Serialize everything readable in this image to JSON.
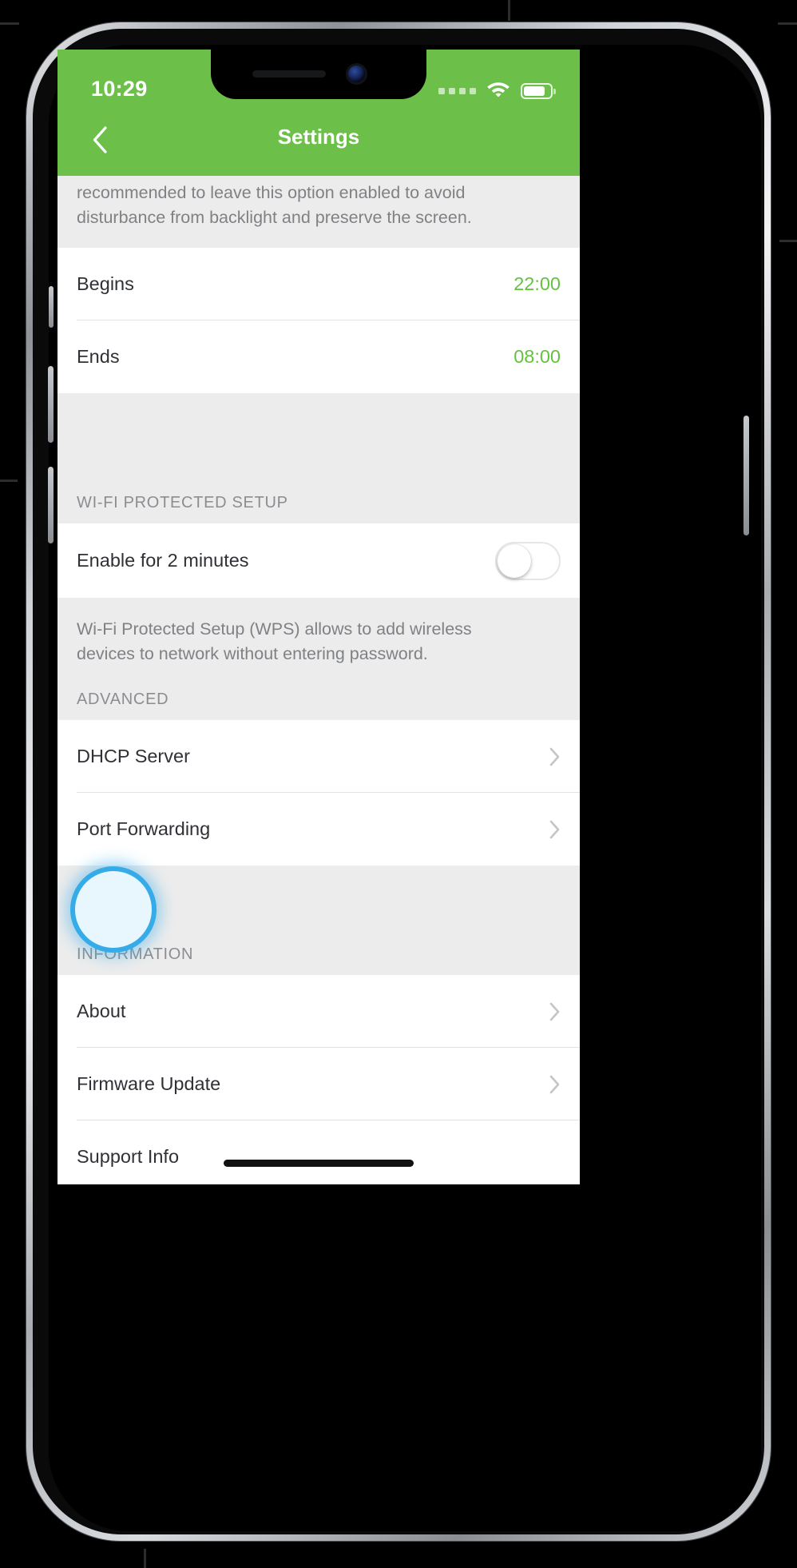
{
  "status_bar": {
    "time": "10:29",
    "signal_dots": 4,
    "wifi_icon": "wifi-icon",
    "battery_icon": "battery-icon",
    "battery_level_pct": 70
  },
  "nav": {
    "back_icon": "chevron-left-icon",
    "title": "Settings"
  },
  "colors": {
    "accent_green": "#6cc04a",
    "value_green": "#64c241",
    "group_bg": "#ececec",
    "row_bg": "#ffffff",
    "highlight_ring": "#35abe8",
    "highlight_fill": "#e8f6fd"
  },
  "night_mode_description": {
    "line1": "recommended to leave this option enabled to avoid",
    "line2": "disturbance from backlight and preserve the screen."
  },
  "schedule_rows": [
    {
      "label": "Begins",
      "value": "22:00"
    },
    {
      "label": "Ends",
      "value": "08:00"
    }
  ],
  "wps": {
    "section_title": "WI-FI PROTECTED SETUP",
    "row_label": "Enable for 2 minutes",
    "toggle_state": "off",
    "description_line1": "Wi-Fi Protected Setup (WPS) allows to add wireless",
    "description_line2": "devices to network without entering password."
  },
  "advanced": {
    "section_title": "ADVANCED",
    "items": [
      {
        "label": "DHCP Server",
        "chevron": "chevron-right-icon",
        "highlighted": false
      },
      {
        "label": "Port Forwarding",
        "chevron": "chevron-right-icon",
        "highlighted": true
      }
    ]
  },
  "information": {
    "section_title": "INFORMATION",
    "items": [
      {
        "label": "About",
        "chevron": "chevron-right-icon"
      },
      {
        "label": "Firmware Update",
        "chevron": "chevron-right-icon"
      },
      {
        "label": "Support Info",
        "chevron": ""
      }
    ]
  },
  "home_indicator": "home-indicator"
}
